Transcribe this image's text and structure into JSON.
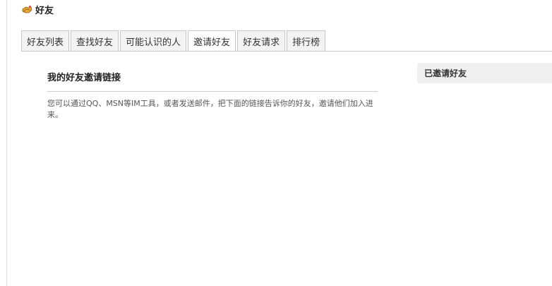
{
  "header": {
    "icon": "friends-hand-icon",
    "title": "好友"
  },
  "tabs": [
    {
      "label": "好友列表",
      "active": false
    },
    {
      "label": "查找好友",
      "active": false
    },
    {
      "label": "可能认识的人",
      "active": false
    },
    {
      "label": "邀请好友",
      "active": true
    },
    {
      "label": "好友请求",
      "active": false
    },
    {
      "label": "排行榜",
      "active": false
    }
  ],
  "main": {
    "title": "我的好友邀请链接",
    "description": "您可以通过QQ、MSN等IM工具，或者发送邮件，把下面的链接告诉你的好友，邀请他们加入进来。"
  },
  "sidebar": {
    "title": "已邀请好友"
  },
  "colors": {
    "tab_background": "#f3f3f3",
    "tab_border": "#c6c6c6",
    "side_background": "#f0f0f0"
  }
}
